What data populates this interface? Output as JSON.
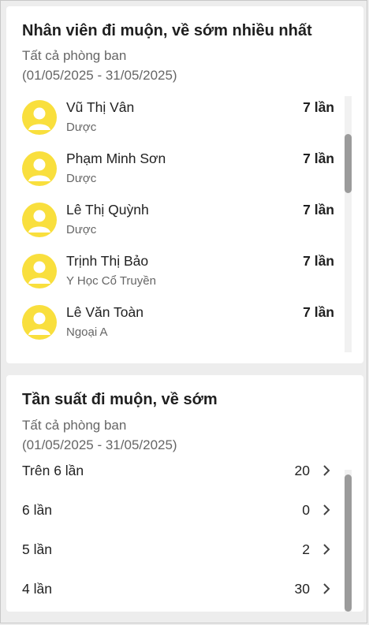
{
  "late_employees": {
    "title": "Nhân viên đi muộn, về sớm nhiều nhất",
    "department_filter": "Tất cả phòng ban",
    "date_range": "(01/05/2025 - 31/05/2025)",
    "items": [
      {
        "name": "Vũ Thị Vân",
        "department": "Dược",
        "count": "7 lần"
      },
      {
        "name": "Phạm Minh Sơn",
        "department": "Dược",
        "count": "7 lần"
      },
      {
        "name": "Lê Thị Quỳnh",
        "department": "Dược",
        "count": "7 lần"
      },
      {
        "name": "Trịnh Thị Bảo",
        "department": "Y Học Cổ Truyền",
        "count": "7 lần"
      },
      {
        "name": "Lê Văn Toàn",
        "department": "Ngoại A",
        "count": "7 lần"
      }
    ]
  },
  "frequency": {
    "title": "Tần suất đi muộn, về sớm",
    "department_filter": "Tất cả phòng ban",
    "date_range": "(01/05/2025 - 31/05/2025)",
    "items": [
      {
        "label": "Trên 6 lần",
        "count": "20"
      },
      {
        "label": "6 lần",
        "count": "0"
      },
      {
        "label": "5 lần",
        "count": "2"
      },
      {
        "label": "4 lần",
        "count": "30"
      }
    ]
  },
  "icons": {
    "avatar": "user-avatar-icon",
    "chevron": "chevron-right-icon"
  },
  "colors": {
    "avatar_bg": "#f9df3d",
    "page_bg": "#ededed",
    "scroll_thumb": "#9b9b9b"
  }
}
